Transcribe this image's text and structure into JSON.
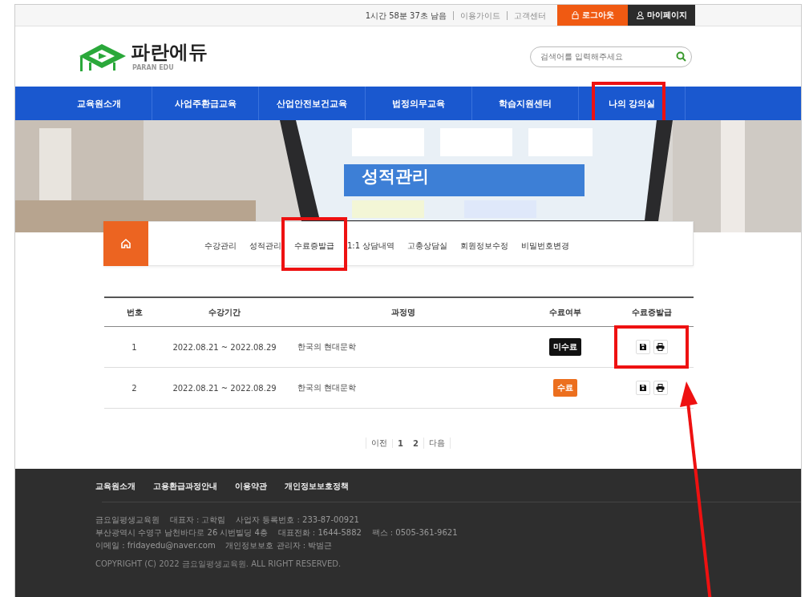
{
  "top_bar": {
    "timer": "1시간 58분 37초 남음",
    "links": [
      "이용가이드",
      "고객센터"
    ],
    "logout": "로그아웃",
    "mypage": "마이페이지"
  },
  "header": {
    "logo_text": "파란에듀",
    "logo_sub": "PARAN EDU",
    "search": {
      "placeholder": "검색어를 입력해주세요"
    }
  },
  "nav": [
    {
      "label": "교육원소개",
      "highlighted": false
    },
    {
      "label": "사업주환급교육",
      "highlighted": false
    },
    {
      "label": "산업안전보건교육",
      "highlighted": false
    },
    {
      "label": "법정의무교육",
      "highlighted": false
    },
    {
      "label": "학습지원센터",
      "highlighted": false
    },
    {
      "label": "나의 강의실",
      "highlighted": true
    }
  ],
  "banner": {
    "title": "성적관리"
  },
  "submenu": [
    {
      "label": "수강관리",
      "highlighted": false
    },
    {
      "label": "성적관리",
      "highlighted": false
    },
    {
      "label": "수료증발급",
      "highlighted": true
    },
    {
      "label": "1:1 상담내역",
      "highlighted": false
    },
    {
      "label": "고충상담실",
      "highlighted": false
    },
    {
      "label": "회원정보수정",
      "highlighted": false
    },
    {
      "label": "비밀번호변경",
      "highlighted": false
    }
  ],
  "table": {
    "columns": [
      "번호",
      "수강기간",
      "과정명",
      "수료여부",
      "수료증발급"
    ],
    "rows": [
      {
        "no": "1",
        "period": "2022.08.21 ~ 2022.08.29",
        "course": "한국의 현대문학",
        "status": {
          "kind": "incomplete",
          "label": "미수료"
        },
        "highlighted": true
      },
      {
        "no": "2",
        "period": "2022.08.21 ~ 2022.08.29",
        "course": "한국의 현대문학",
        "status": {
          "kind": "complete",
          "label": "수료"
        },
        "highlighted": false
      }
    ]
  },
  "pagination": {
    "prev": "이전",
    "pages": [
      "1",
      "2"
    ],
    "next": "다음"
  },
  "footer": {
    "links": [
      "교육원소개",
      "고용환급과정안내",
      "이용약관",
      "개인정보보호정책"
    ],
    "info": [
      "금요일평생교육원    대표자 : 고학림    사업자 등록번호 : 233-87-00921",
      "부산광역시 수영구 남천바다로 26 시번빌딩 4층    대표전화 : 1644-5882    팩스 : 0505-361-9621",
      "이메일 : fridayedu@naver.com    개인정보보호 관리자 : 박범근"
    ],
    "copyright": "COPYRIGHT (C) 2022 금요일평생교육원. ALL RIGHT RESERVED."
  }
}
